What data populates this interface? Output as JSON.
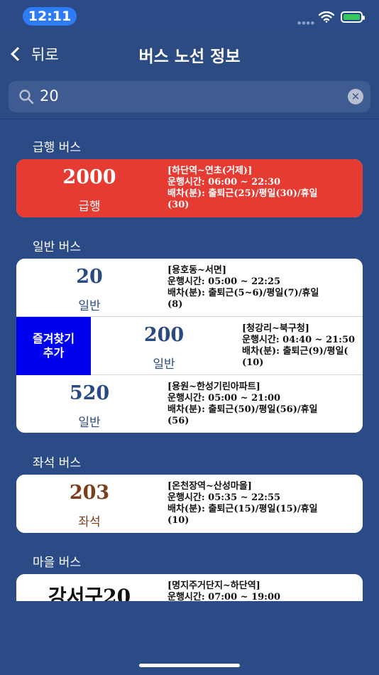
{
  "status_bar": {
    "time": "12:11"
  },
  "nav": {
    "back_label": "뒤로",
    "title": "버스 노선 정보"
  },
  "search": {
    "value": "20"
  },
  "sections": {
    "express": {
      "title": "급행 버스",
      "routes": [
        {
          "number": "2000",
          "type": "급행",
          "line1": "[하단역~연초(거제)]",
          "line2": "운행시간: 06:00 ~ 22:30",
          "line3": "배차(분): 출퇴근(25)/평일(30)/휴일",
          "line4": "(30)"
        }
      ]
    },
    "general": {
      "title": "일반 버스",
      "favorite_action": "즐겨찾기\n추가",
      "routes": [
        {
          "number": "20",
          "type": "일반",
          "line1": "[용호동~서면]",
          "line2": "운행시간: 05:00 ~ 22:25",
          "line3": "배차(분): 출퇴근(5~6)/평일(7)/휴일",
          "line4": "(8)"
        },
        {
          "number": "200",
          "type": "일반",
          "line1": "[청강리~북구청]",
          "line2": "운행시간: 04:40 ~ 21:50",
          "line3": "배차(분): 출퇴근(9)/평일(",
          "line4": "(10)"
        },
        {
          "number": "520",
          "type": "일반",
          "line1": "[용원~한성기린아파트]",
          "line2": "운행시간: 05:00 ~ 21:00",
          "line3": "배차(분): 출퇴근(50)/평일(56)/휴일",
          "line4": "(56)"
        }
      ]
    },
    "seat": {
      "title": "좌석 버스",
      "routes": [
        {
          "number": "203",
          "type": "좌석",
          "line1": "[온천장역~산성마을]",
          "line2": "운행시간: 05:35 ~ 22:55",
          "line3": "배차(분): 출퇴근(15)/평일(15)/휴일",
          "line4": "(10)"
        }
      ]
    },
    "village": {
      "title": "마을 버스",
      "routes": [
        {
          "number": "강서구20",
          "line1": "[명지주거단지~하단역]",
          "line2": "운행시간: 07:00 ~ 19:00"
        }
      ]
    }
  },
  "colors": {
    "background": "#2b4b86",
    "express_red": "#e53b32",
    "general_blue": "#2a4a84",
    "seat_brown": "#7a3e1c",
    "favorite_blue": "#0000f0"
  }
}
